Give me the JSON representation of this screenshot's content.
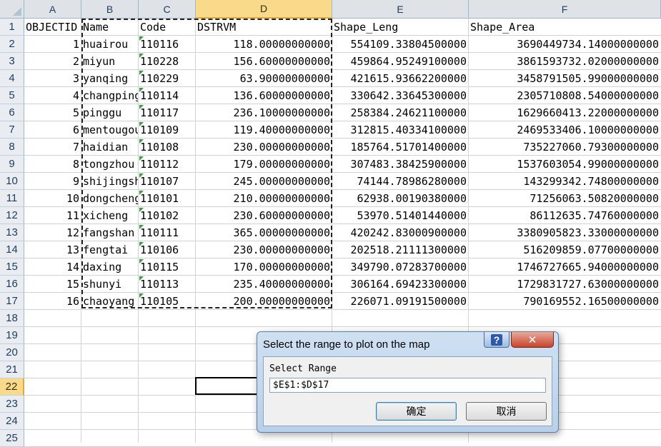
{
  "columns": [
    "A",
    "B",
    "C",
    "D",
    "E",
    "F"
  ],
  "rows": [
    "1",
    "2",
    "3",
    "4",
    "5",
    "6",
    "7",
    "8",
    "9",
    "10",
    "11",
    "12",
    "13",
    "14",
    "15",
    "16",
    "17",
    "18",
    "19",
    "20",
    "21",
    "22",
    "23",
    "24",
    "25"
  ],
  "header_row": [
    "OBJECTID",
    "Name",
    "Code",
    "DSTRVM",
    "Shape_Leng",
    "Shape_Area"
  ],
  "data_rows": [
    [
      "1",
      "huairou",
      "110116",
      "118.00000000000",
      "554109.33804500000",
      "3690449734.14000000000"
    ],
    [
      "2",
      "miyun",
      "110228",
      "156.60000000000",
      "459864.95249100000",
      "3861593732.02000000000"
    ],
    [
      "3",
      "yanqing",
      "110229",
      "63.90000000000",
      "421615.93662200000",
      "3458791505.99000000000"
    ],
    [
      "4",
      "changping",
      "110114",
      "136.60000000000",
      "330642.33645300000",
      "2305710808.54000000000"
    ],
    [
      "5",
      "pinggu",
      "110117",
      "236.10000000000",
      "258384.24621100000",
      "1629660413.22000000000"
    ],
    [
      "6",
      "mentougou",
      "110109",
      "119.40000000000",
      "312815.40334100000",
      "2469533406.10000000000"
    ],
    [
      "7",
      "haidian",
      "110108",
      "230.00000000000",
      "185764.51701400000",
      "735227060.79300000000"
    ],
    [
      "8",
      "tongzhou",
      "110112",
      "179.00000000000",
      "307483.38425900000",
      "1537603054.99000000000"
    ],
    [
      "9",
      "shijingshan",
      "110107",
      "245.00000000000",
      "74144.78986280000",
      "143299342.74800000000"
    ],
    [
      "10",
      "dongcheng",
      "110101",
      "210.00000000000",
      "62938.00190380000",
      "71256063.50820000000"
    ],
    [
      "11",
      "xicheng",
      "110102",
      "230.60000000000",
      "53970.51401440000",
      "86112635.74760000000"
    ],
    [
      "12",
      "fangshan",
      "110111",
      "365.00000000000",
      "420242.83000900000",
      "3380905823.33000000000"
    ],
    [
      "13",
      "fengtai",
      "110106",
      "230.00000000000",
      "202518.21111300000",
      "516209859.07700000000"
    ],
    [
      "14",
      "daxing",
      "110115",
      "170.00000000000",
      "349790.07283700000",
      "1746727665.94000000000"
    ],
    [
      "15",
      "shunyi",
      "110113",
      "235.40000000000",
      "306164.69423300000",
      "1729831727.63000000000"
    ],
    [
      "16",
      "chaoyang",
      "110105",
      "200.00000000000",
      "226071.09191500000",
      "790169552.16500000000"
    ]
  ],
  "selected_column": "D",
  "selected_row": "22",
  "dialog": {
    "title": "Select the range to plot on the map",
    "help_label": "?",
    "close_label": "✕",
    "range_label": "Select Range",
    "range_value": "$E$1:$D$17",
    "ok_label": "确定",
    "cancel_label": "取消"
  },
  "colors": {
    "header_bg": "#dfe3e8",
    "selected_header": "#f9d98a",
    "dialog_bg": "#b9d0ea",
    "error_indicator": "#3a9b3a"
  }
}
